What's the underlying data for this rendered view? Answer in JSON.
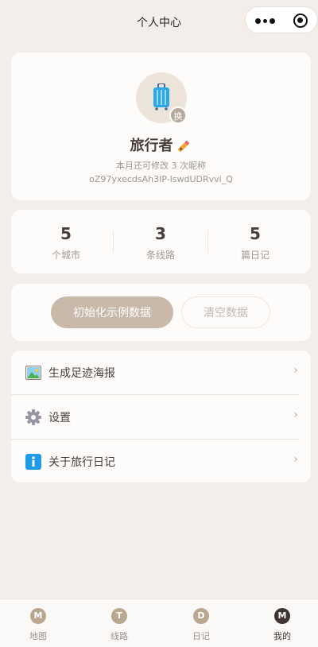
{
  "navbar": {
    "title": "个人中心"
  },
  "profile": {
    "swap_label": "换",
    "nickname": "旅行者",
    "quota": "本月还可修改 3 次昵称",
    "openid": "oZ97yxecdsAh3IP-lswdUDRvvi_Q",
    "icons": {
      "avatar": "suitcase-icon",
      "edit": "pencil-icon"
    }
  },
  "stats": [
    {
      "value": "5",
      "label": "个城市"
    },
    {
      "value": "3",
      "label": "条线路"
    },
    {
      "value": "5",
      "label": "篇日记"
    }
  ],
  "actions": {
    "init_label": "初始化示例数据",
    "clear_label": "清空数据"
  },
  "menu": [
    {
      "label": "生成足迹海报",
      "icon": "picture-icon",
      "arrow": "›"
    },
    {
      "label": "设置",
      "icon": "gear-icon",
      "arrow": "›"
    },
    {
      "label": "关于旅行日记",
      "icon": "info-icon",
      "arrow": "›"
    }
  ],
  "tabbar": [
    {
      "letter": "M",
      "label": "地图",
      "active": false
    },
    {
      "letter": "T",
      "label": "线路",
      "active": false
    },
    {
      "letter": "D",
      "label": "日记",
      "active": false
    },
    {
      "letter": "M",
      "label": "我的",
      "active": true
    }
  ],
  "colors": {
    "background": "#f3eeea",
    "primary_button": "#c8b9aa",
    "tab_icon": "#b9a78f",
    "tab_active": "#3e3531"
  }
}
